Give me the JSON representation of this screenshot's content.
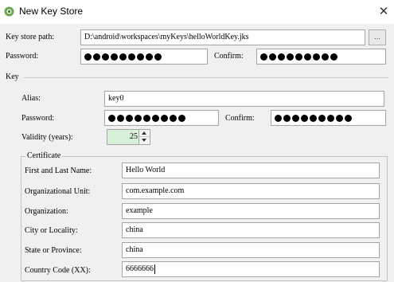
{
  "window": {
    "title": "New Key Store",
    "close_glyph": "✕"
  },
  "keystore": {
    "path_label": "Key store path:",
    "path_value": "D:\\android\\workspaces\\myKeys\\helloWorldKey.jks",
    "browse_label": "...",
    "password_label": "Password:",
    "password_dot_count": 9,
    "confirm_label": "Confirm:",
    "confirm_dot_count": 9
  },
  "key": {
    "section_label": "Key",
    "alias_label": "Alias:",
    "alias_value": "key0",
    "password_label": "Password:",
    "password_dot_count": 9,
    "confirm_label": "Confirm:",
    "confirm_dot_count": 9,
    "validity_label": "Validity (years):",
    "validity_value": "25"
  },
  "certificate": {
    "legend": "Certificate",
    "fields": [
      {
        "label": "First and Last Name:",
        "value": "Hello World"
      },
      {
        "label": "Organizational Unit:",
        "value": "com.example.com"
      },
      {
        "label": "Organization:",
        "value": "example"
      },
      {
        "label": "City or Locality:",
        "value": "china"
      },
      {
        "label": "State or Province:",
        "value": "china"
      },
      {
        "label": "Country Code (XX):",
        "value": "6666666"
      }
    ]
  },
  "icons": {
    "app": "android-studio-icon",
    "close": "close-icon",
    "spin_up": "chevron-up-icon",
    "spin_down": "chevron-down-icon"
  },
  "colors": {
    "validity_bg": "#d8efd8",
    "app_icon": "#6aa84f"
  }
}
